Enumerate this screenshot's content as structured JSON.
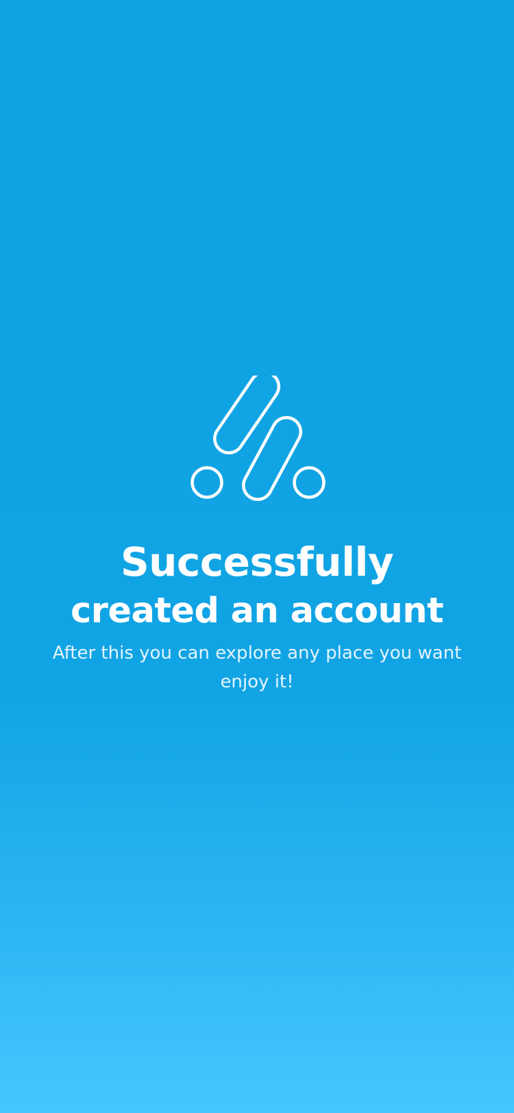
{
  "screen": {
    "background_top": "#0fa2e2",
    "background_bottom": "#47c6fe",
    "accent": "#ffffff"
  },
  "logo": {
    "icon": "app-logo-icon"
  },
  "title": {
    "line1": "Successfully",
    "line2": "created an account"
  },
  "subtitle": {
    "text": "After this you can explore any place you want enjoy it!"
  }
}
